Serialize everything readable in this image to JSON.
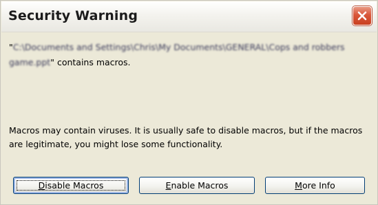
{
  "window": {
    "title": "Security Warning"
  },
  "message": {
    "open_quote": "\"",
    "path": "C:\\Documents and Settings\\Chris\\My Documents\\GENERAL\\Cops and robbers game.ppt",
    "suffix": "\" contains macros."
  },
  "warning_text": "Macros may contain viruses. It is usually safe to disable macros, but if the macros are legitimate, you might lose some functionality.",
  "buttons": {
    "disable": {
      "mnemonic": "D",
      "rest": "isable Macros"
    },
    "enable": {
      "mnemonic": "E",
      "rest": "nable Macros"
    },
    "more": {
      "mnemonic": "M",
      "rest": "ore Info"
    }
  },
  "icons": {
    "close": "close-icon"
  },
  "colors": {
    "dialog_background": "#ece9d8",
    "close_button": "#d9573a",
    "button_border": "#003c74"
  }
}
